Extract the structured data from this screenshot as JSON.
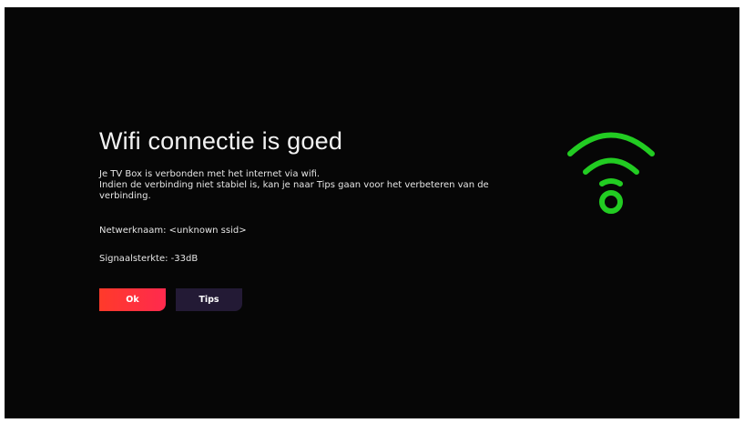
{
  "dialog": {
    "title": "Wifi connectie is goed",
    "description_lines": [
      "Je TV Box is verbonden met het internet via wifi.",
      "Indien de verbinding niet stabiel is, kan je naar Tips gaan voor het verbeteren van de",
      "verbinding."
    ],
    "network_name": "Netwerknaam: <unknown ssid>",
    "signal_strength": "Signaalsterkte: -33dB"
  },
  "buttons": {
    "ok_label": "Ok",
    "tips_label": "Tips"
  },
  "icon": {
    "name": "wifi-icon",
    "color": "#22cc22"
  },
  "colors": {
    "background": "#060606",
    "ok_button": "#ff3340",
    "tips_button": "#231a35",
    "text": "#f2f2f2"
  }
}
